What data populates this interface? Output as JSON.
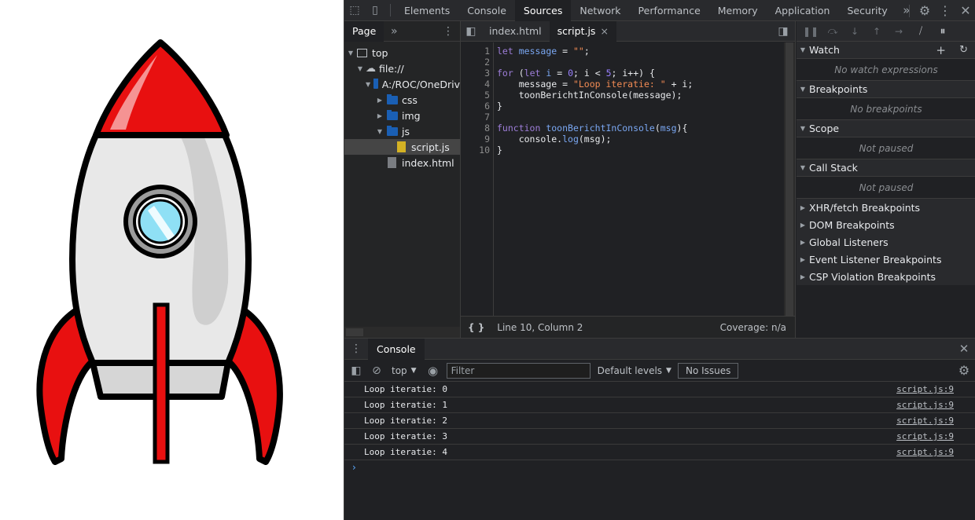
{
  "topbar": {
    "tabs": [
      "Elements",
      "Console",
      "Sources",
      "Network",
      "Performance",
      "Memory",
      "Application",
      "Security"
    ],
    "active_tab": "Sources",
    "more_label": "»"
  },
  "navigator": {
    "tab_label": "Page",
    "more_label": "»",
    "tree": [
      {
        "label": "top",
        "depth": 0,
        "kind": "frame",
        "expanded": true
      },
      {
        "label": "file://",
        "depth": 1,
        "kind": "cloud",
        "expanded": true
      },
      {
        "label": "A:/ROC/OneDriv",
        "depth": 2,
        "kind": "folder",
        "expanded": true
      },
      {
        "label": "css",
        "depth": 3,
        "kind": "folder",
        "expanded": false
      },
      {
        "label": "img",
        "depth": 3,
        "kind": "folder",
        "expanded": false
      },
      {
        "label": "js",
        "depth": 3,
        "kind": "folder",
        "expanded": true
      },
      {
        "label": "script.js",
        "depth": 4,
        "kind": "file-js",
        "selected": true
      },
      {
        "label": "index.html",
        "depth": 3,
        "kind": "file-html"
      }
    ]
  },
  "editor": {
    "tabs": [
      {
        "label": "index.html",
        "active": false
      },
      {
        "label": "script.js",
        "active": true,
        "closable": true
      }
    ],
    "close_glyph": "×",
    "line_numbers": [
      "1",
      "2",
      "3",
      "4",
      "5",
      "6",
      "7",
      "8",
      "9",
      "10"
    ],
    "status_position": "Line 10, Column 2",
    "status_coverage": "Coverage: n/a",
    "pretty_print_label": "{ }"
  },
  "debugger": {
    "sections": [
      {
        "title": "Watch",
        "body": "No watch expressions",
        "expanded": true
      },
      {
        "title": "Breakpoints",
        "body": "No breakpoints",
        "expanded": true
      },
      {
        "title": "Scope",
        "body": "Not paused",
        "expanded": true
      },
      {
        "title": "Call Stack",
        "body": "Not paused",
        "expanded": true
      }
    ],
    "collapsed": [
      "XHR/fetch Breakpoints",
      "DOM Breakpoints",
      "Global Listeners",
      "Event Listener Breakpoints",
      "CSP Violation Breakpoints"
    ]
  },
  "console": {
    "tab_label": "Console",
    "context": "top",
    "filter_placeholder": "Filter",
    "levels_label": "Default levels",
    "issues_label": "No Issues",
    "messages": [
      {
        "text": "Loop iteratie: 0",
        "source": "script.js:9"
      },
      {
        "text": "Loop iteratie: 1",
        "source": "script.js:9"
      },
      {
        "text": "Loop iteratie: 2",
        "source": "script.js:9"
      },
      {
        "text": "Loop iteratie: 3",
        "source": "script.js:9"
      },
      {
        "text": "Loop iteratie: 4",
        "source": "script.js:9"
      }
    ],
    "prompt": "›"
  },
  "colors": {
    "rocket_red": "#e81010",
    "rocket_body": "#e8e8e8",
    "window_blue": "#8fe0f5",
    "devtools_bg": "#202124"
  }
}
